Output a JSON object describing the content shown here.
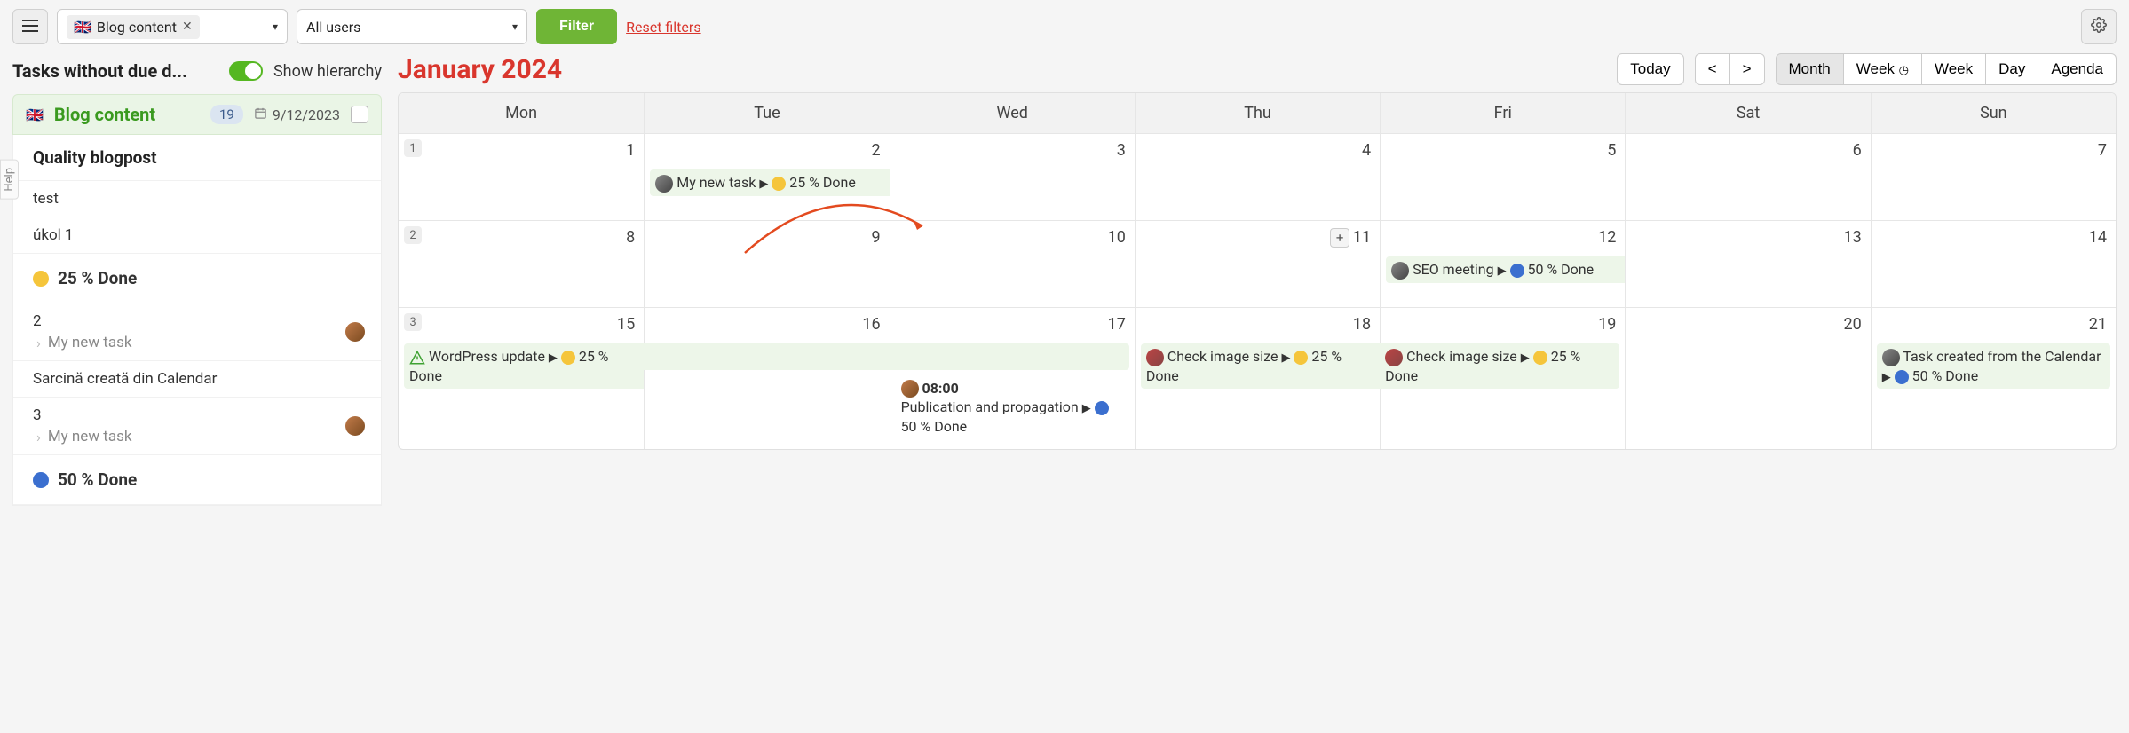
{
  "topbar": {
    "chip_flag": "🇬🇧",
    "chip_label": "Blog content",
    "users_select": "All users",
    "filter_btn": "Filter",
    "reset_link": "Reset filters"
  },
  "side": {
    "title": "Tasks without due d...",
    "show_hierarchy": "Show hierarchy",
    "project": {
      "flag": "🇬🇧",
      "name": "Blog content",
      "count": "19",
      "date": "9/12/2023"
    },
    "heading": "Quality blogpost",
    "rows": {
      "test": "test",
      "ukol1": "úkol 1",
      "status25": "25 % Done",
      "n2": "2",
      "mynewtask_a": "My new task",
      "sarcina": "Sarcină creată din Calendar",
      "n3": "3",
      "mynewtask_b": "My new task",
      "status50": "50 % Done"
    }
  },
  "help_tab": "Help",
  "calendar": {
    "title": "January 2024",
    "today_btn": "Today",
    "prev": "<",
    "next": ">",
    "views": {
      "month": "Month",
      "week_clock": "Week",
      "week": "Week",
      "day": "Day",
      "agenda": "Agenda"
    },
    "dow": [
      "Mon",
      "Tue",
      "Wed",
      "Thu",
      "Fri",
      "Sat",
      "Sun"
    ],
    "week_numbers": [
      "1",
      "2",
      "3"
    ],
    "dates_r1": [
      "1",
      "2",
      "3",
      "4",
      "5",
      "6",
      "7"
    ],
    "dates_r2": [
      "8",
      "9",
      "10",
      "11",
      "12",
      "13",
      "14"
    ],
    "dates_r3": [
      "15",
      "16",
      "17",
      "18",
      "19",
      "20",
      "21"
    ],
    "add_plus": "+",
    "events": {
      "mynewtask": {
        "title": "My new task",
        "status": "25 % Done"
      },
      "seomeeting": {
        "title": "SEO meeting",
        "status": "50 % Done"
      },
      "wpupdate": {
        "title": "WordPress update",
        "status": "25 % Done"
      },
      "pub": {
        "time": "08:00",
        "title": "Publication and propagation",
        "status": "50 % Done"
      },
      "checkimg": {
        "title": "Check image size",
        "status": "25 % Done"
      },
      "taskcal": {
        "title": "Task created from the Calendar",
        "status": "50 % Done"
      }
    }
  }
}
